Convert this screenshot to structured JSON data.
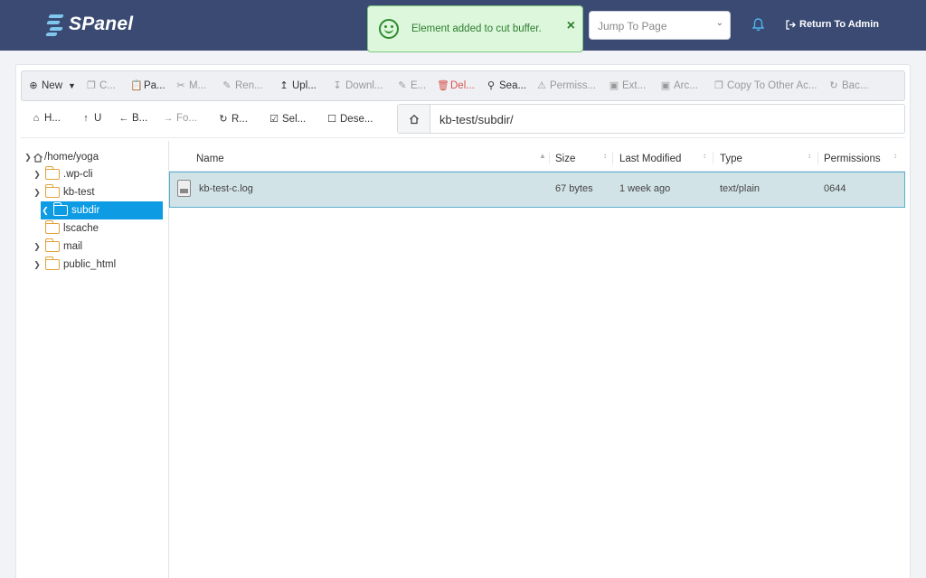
{
  "header": {
    "logo_text": "SPanel",
    "jump_placeholder": "Jump To Page",
    "return_label": "Return To Admin"
  },
  "toast": {
    "message": "Element added to cut buffer.",
    "close": "×"
  },
  "toolbar": {
    "new": "New",
    "copy": "C...",
    "paste": "Pa...",
    "move": "M...",
    "rename": "Ren...",
    "upload": "Upl...",
    "download": "Downl...",
    "edit": "E...",
    "delete": "Del...",
    "search": "Sea...",
    "permissions": "Permiss...",
    "extract": "Ext...",
    "archive": "Arc...",
    "copy_other": "Copy To Other Ac...",
    "backup": "Bac..."
  },
  "toolbar2": {
    "home": "H...",
    "up": "U",
    "back": "B...",
    "forward": "Fo...",
    "refresh": "R...",
    "select": "Sel...",
    "deselect": "Dese..."
  },
  "path": "kb-test/subdir/",
  "tree": {
    "root": "/home/yoga",
    "items": [
      {
        "label": ".wp-cli"
      },
      {
        "label": "kb-test"
      },
      {
        "label": "subdir"
      },
      {
        "label": "lscache"
      },
      {
        "label": "mail"
      },
      {
        "label": "public_html"
      }
    ]
  },
  "table": {
    "headers": [
      "Name",
      "Size",
      "Last Modified",
      "Type",
      "Permissions"
    ],
    "rows": [
      {
        "name": "kb-test-c.log",
        "size": "67 bytes",
        "modified": "1 week ago",
        "type": "text/plain",
        "perms": "0644"
      }
    ]
  },
  "colors": {
    "header_bg": "#3a4a73",
    "selected": "#0d9be4",
    "toast_bg": "#dcf7dc",
    "delete": "#d9534f"
  }
}
